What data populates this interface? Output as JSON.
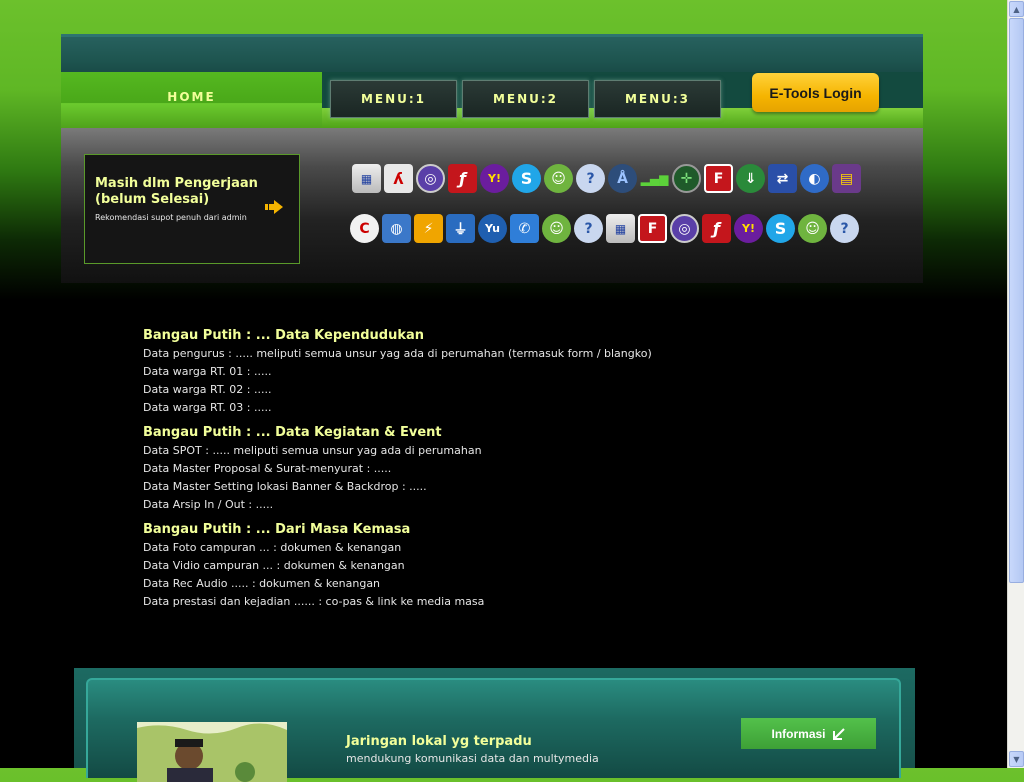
{
  "nav": {
    "home": "HOME",
    "menu1": "MENU:1",
    "menu2": "MENU:2",
    "menu3": "MENU:3",
    "login": "E-Tools Login"
  },
  "banner": {
    "title": "Masih dlm Pengerjaan (belum Selesai)",
    "subtitle": "Rekomendasi supot penuh dari admin",
    "icons_row1": [
      "monitor-icon",
      "pdf-icon",
      "torrent-icon",
      "flash-icon",
      "yahoo-icon",
      "skype-icon",
      "messenger-icon",
      "chat-icon",
      "antenna-icon",
      "signal-icon",
      "radar-icon",
      "filezilla-icon",
      "download-manager-icon",
      "network-icon",
      "google-earth-icon",
      "winrar-icon"
    ],
    "icons_row2": [
      "ccleaner-icon",
      "network-globe-icon",
      "lightning-icon",
      "usb-icon",
      "yu-icon",
      "phone-icon",
      "messenger-icon",
      "chat-icon",
      "monitor-icon",
      "filezilla-icon",
      "torrent-icon",
      "flash-icon",
      "yahoo-icon",
      "skype-icon",
      "messenger-icon",
      "chat-icon"
    ]
  },
  "sections": [
    {
      "title": "Bangau Putih : ... Data Kependudukan",
      "lines": [
        "Data pengurus : ..... meliputi semua unsur yag ada di perumahan (termasuk form / blangko)",
        "Data warga RT. 01 : .....",
        "Data warga RT. 02 : .....",
        "Data warga RT. 03 : ....."
      ]
    },
    {
      "title": "Bangau Putih : ... Data Kegiatan & Event",
      "lines": [
        "Data SPOT : ..... meliputi semua unsur yag ada di perumahan",
        "Data Master Proposal & Surat-menyurat : .....",
        "Data Master Setting lokasi Banner & Backdrop : .....",
        "Data Arsip In / Out : ....."
      ]
    },
    {
      "title": "Bangau Putih : ... Dari Masa Kemasa",
      "lines": [
        "Data Foto campuran ... : dokumen & kenangan",
        "Data Vidio campuran ... : dokumen & kenangan",
        "Data Rec Audio ..... : dokumen & kenangan",
        "Data prestasi dan kejadian ...... : co-pas & link ke media masa"
      ]
    }
  ],
  "footer": {
    "title": "Jaringan lokal yg terpadu",
    "subtitle": "mendukung komunikasi data dan multymedia",
    "button": "Informasi"
  }
}
